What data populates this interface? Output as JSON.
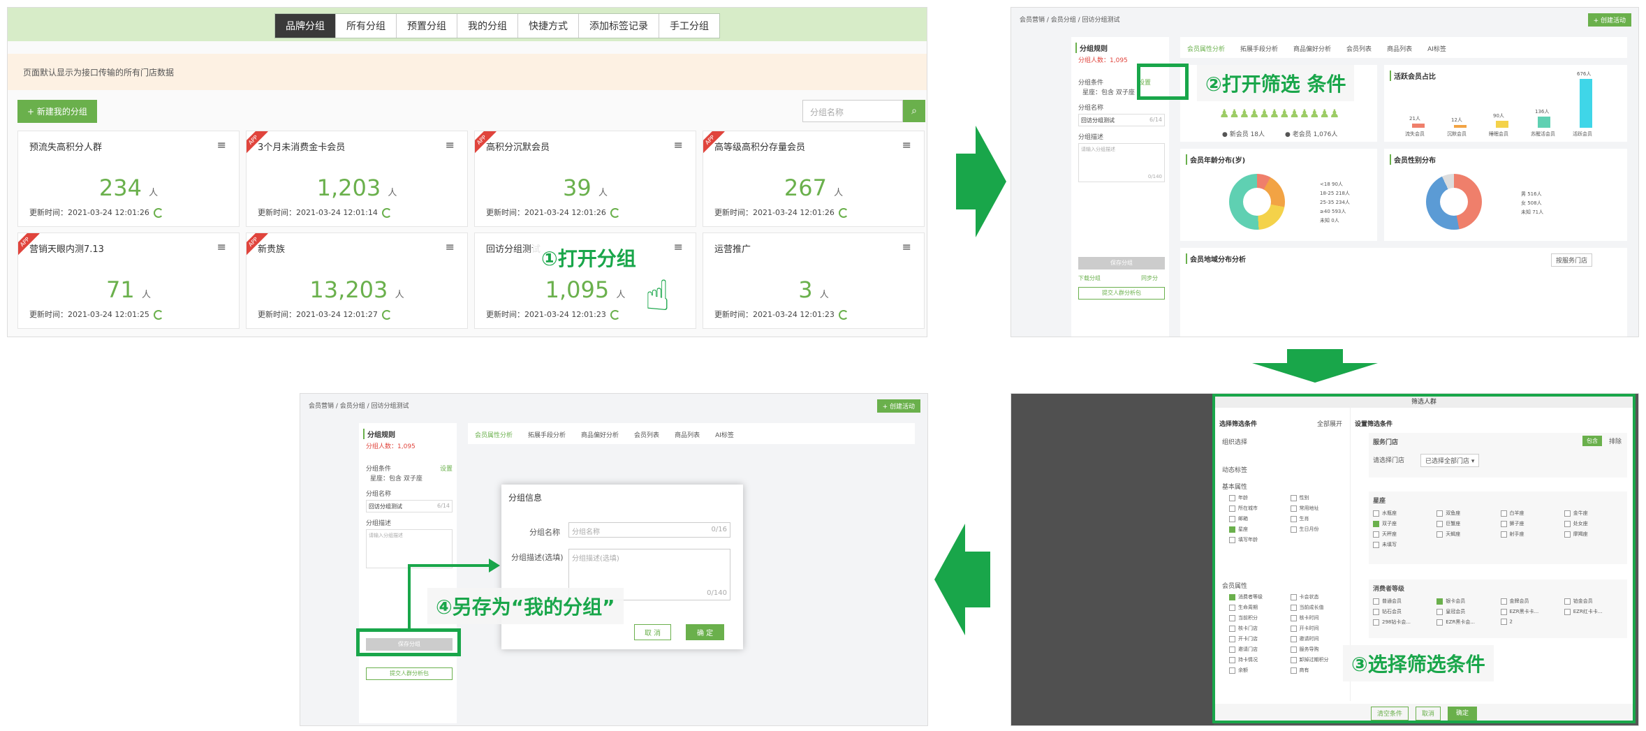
{
  "p1": {
    "tabs": [
      "品牌分组",
      "所有分组",
      "预置分组",
      "我的分组",
      "快捷方式",
      "添加标签记录",
      "手工分组"
    ],
    "notice": "页面默认显示为接口传输的所有门店数据",
    "new_btn": "新建我的分组",
    "search_placeholder": "分组名称",
    "unit": "人",
    "cards": [
      {
        "title": "预流失高积分人群",
        "num": "234",
        "updated": "更新时间：2021-03-24 12:01:26",
        "app": false
      },
      {
        "title": "3个月未消费金卡会员",
        "num": "1,203",
        "updated": "更新时间：2021-03-24 12:01:14",
        "app": true
      },
      {
        "title": "高积分沉默会员",
        "num": "39",
        "updated": "更新时间：2021-03-24 12:01:26",
        "app": true
      },
      {
        "title": "高等级高积分存量会员",
        "num": "267",
        "updated": "更新时间：2021-03-24 12:01:26",
        "app": true
      },
      {
        "title": "营销天眼内测7.13",
        "num": "71",
        "updated": "更新时间：2021-03-24 12:01:25",
        "app": true
      },
      {
        "title": "新贵族",
        "num": "13,203",
        "updated": "更新时间：2021-03-24 12:01:27",
        "app": true
      },
      {
        "title": "回访分组测试",
        "num": "1,095",
        "updated": "更新时间：2021-03-24 12:01:23",
        "app": false
      },
      {
        "title": "运营推广",
        "num": "3",
        "updated": "更新时间：2021-03-24 12:01:23",
        "app": false
      }
    ],
    "app_badge": "APP",
    "callout": "①打开分组"
  },
  "p2": {
    "breadcrumb": "会员营销 / 会员分组 / 回访分组测试",
    "create_btn": "+ 创建活动",
    "rule_title": "分组规则",
    "count_label": "分组人数：1,095",
    "cond_label": "分组条件",
    "set_link": "设置",
    "cond_val": "星座：包含 双子座",
    "name_label": "分组名称",
    "name_val": "回访分组测试",
    "name_count": "6/14",
    "desc_label": "分组描述",
    "desc_placeholder": "请输入分组描述",
    "desc_count": "0/140",
    "save_btn": "保存分组",
    "download": "下载分组",
    "resync": "同步分",
    "analysis_btn": "提交人群分析包",
    "tabs": [
      "会员属性分析",
      "拓展手段分析",
      "商品偏好分析",
      "会员列表",
      "商品列表",
      "AI标签"
    ],
    "ratio_title": "活跃会员占比",
    "age_title": "会员年龄分布(岁)",
    "gender_title": "会员性别分布",
    "region_title": "会员地域分布分析",
    "region_select": "按服务门店",
    "age_legend": [
      "<18  90人",
      "18-25  218人",
      "25-35  234人",
      "≥40  593人",
      "未知  0人"
    ],
    "gender_legend": [
      "男  516人",
      "女  508人",
      "未知  71人"
    ],
    "bar_labels": [
      "流失会员",
      "沉默会员",
      "睡眠会员",
      "苏醒活会员",
      "活跃会员"
    ],
    "bar_values": [
      "21人",
      "12人",
      "90人",
      "136人",
      "676人"
    ],
    "new_member": "● 新会员 18人",
    "old_member": "● 老会员 1,076人",
    "callout": "②打开筛选 条件"
  },
  "p3": {
    "modal_title": "筛选人群",
    "left_title": "选择筛选条件",
    "expand_all": "全部展开",
    "right_title": "设置筛选条件",
    "sections": [
      "组织选择",
      "动态标签",
      "基本属性",
      "会员属性"
    ],
    "basic": [
      "年龄",
      "性别",
      "所在城市",
      "常用地址",
      "邮箱",
      "生肖",
      "星座",
      "生日月份",
      "填写年龄"
    ],
    "member": [
      "消费者等级",
      "卡会状态",
      "生命周期",
      "当前成长值",
      "当前积分",
      "核卡时间",
      "核卡门店",
      "开卡时间",
      "开卡门店",
      "邀请时间",
      "邀请门店",
      "服务导购",
      "持卡情况",
      "卸掉过期积分",
      "余额",
      "商有"
    ],
    "store_title": "服务门店",
    "store_label": "请选择门店",
    "store_select": "已选择全部门店 ▾",
    "include": "包含",
    "exclude": "排除",
    "zodiac_title": "星座",
    "zodiac": [
      "水瓶座",
      "双鱼座",
      "白羊座",
      "金牛座",
      "双子座",
      "巨蟹座",
      "狮子座",
      "处女座",
      "天秤座",
      "天蝎座",
      "射手座",
      "摩羯座",
      "未填写"
    ],
    "level_title": "消费者等级",
    "levels": [
      "普通会员",
      "银卡会员",
      "金牌会员",
      "铂金会员",
      "钻石会员",
      "皇冠会员",
      "EZR黑卡卡...",
      "EZR红卡卡...",
      "298钻卡会...",
      "EZR黑卡会...",
      "2"
    ],
    "bottom_btns": [
      "清空条件",
      "取消",
      "确定"
    ],
    "callout": "③选择筛选条件"
  },
  "p4": {
    "modal_title": "分组信息",
    "name_label": "分组名称",
    "name_placeholder": "分组名称",
    "name_count": "0/16",
    "desc_label": "分组描述(选填)",
    "desc_placeholder": "分组描述(选填)",
    "desc_count": "0/140",
    "cancel": "取 消",
    "ok": "确 定",
    "callout": "④另存为“我的分组”"
  },
  "colors": {
    "brand": "#19a64a",
    "accent": "#6ab04c",
    "app_badge": "#e0443c"
  }
}
